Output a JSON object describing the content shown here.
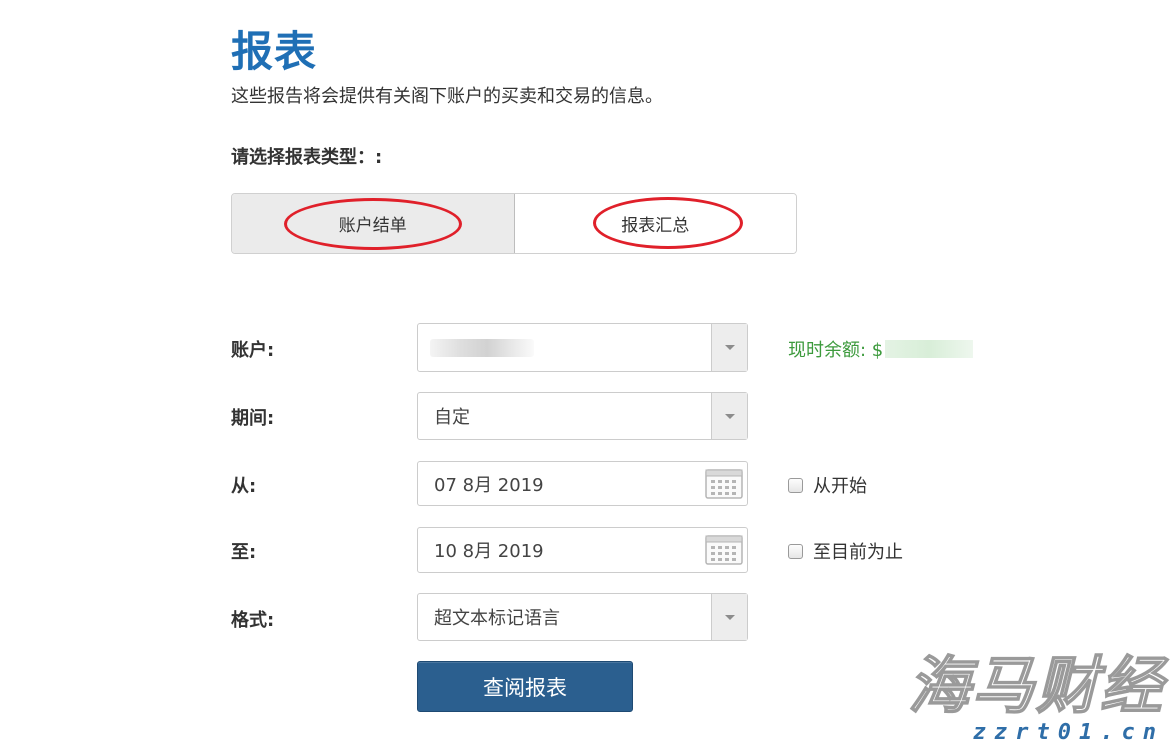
{
  "page": {
    "title": "报表",
    "subtitle": "这些报告将会提供有关阁下账户的买卖和交易的信息。",
    "select_type_label": "请选择报表类型：:"
  },
  "tabs": [
    {
      "label": "账户结单",
      "active": true
    },
    {
      "label": "报表汇总",
      "active": false
    }
  ],
  "form": {
    "account": {
      "label": "账户:",
      "value": ""
    },
    "balance_label": "现时余额: $",
    "period": {
      "label": "期间:",
      "value": "自定"
    },
    "from": {
      "label": "从:",
      "value": "07 8月 2019",
      "checkbox_label": "从开始"
    },
    "to": {
      "label": "至:",
      "value": "10 8月 2019",
      "checkbox_label": "至目前为止"
    },
    "format": {
      "label": "格式:",
      "value": "超文本标记语言"
    },
    "submit_label": "查阅报表"
  },
  "watermark": {
    "main": "海马财经",
    "sub": "zzrt01.cn"
  },
  "colors": {
    "title": "#1f6fb5",
    "balance": "#3c9a3c",
    "button": "#2b5f8f",
    "annotation": "#e0202a"
  }
}
